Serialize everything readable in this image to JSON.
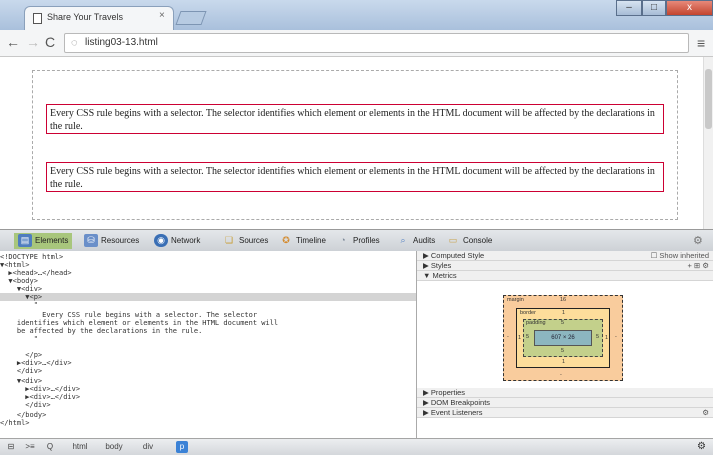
{
  "browser": {
    "tab_title": "Share Your Travels",
    "tab_close": "×",
    "url": "listing03-13.html",
    "window_controls": {
      "minimize": "–",
      "maximize": "□",
      "close": "x"
    }
  },
  "page": {
    "paragraphs": [
      "Every CSS rule begins with a selector. The selector identifies which element or elements in the HTML document will be affected by the declarations in the rule.",
      "Every CSS rule begins with a selector. The selector identifies which element or elements in the HTML document will be affected by the declarations in the rule."
    ]
  },
  "devtools": {
    "tabs": [
      {
        "label": "Elements",
        "icon": "elements-icon",
        "color": "#4f7dbf"
      },
      {
        "label": "Resources",
        "icon": "resources-icon",
        "color": "#6a8fc9"
      },
      {
        "label": "Network",
        "icon": "network-icon",
        "color": "#3a6fb5"
      },
      {
        "label": "Sources",
        "icon": "sources-icon",
        "color": "#e0b84a"
      },
      {
        "label": "Timeline",
        "icon": "timeline-icon",
        "color": "#d48a2c"
      },
      {
        "label": "Profiles",
        "icon": "profiles-icon",
        "color": "#9aa5b3"
      },
      {
        "label": "Audits",
        "icon": "audits-icon",
        "color": "#5b86c4"
      },
      {
        "label": "Console",
        "icon": "console-icon",
        "color": "#c9a24a"
      }
    ],
    "dom_tree": [
      "<!DOCTYPE html>",
      "▼<html>",
      "  ▶<head>…</head>",
      "  ▼<body>",
      "    ▼<div>",
      "      ▼<p>",
      "        \"",
      "          Every CSS rule begins with a selector. The selector",
      "    identifies which element or elements in the HTML document will",
      "    be affected by the declarations in the rule.",
      "        \"",
      "      </p>",
      "    ▶<div>…</div>",
      "    </div>",
      "    ▼<div>",
      "      ▶<div>…</div>",
      "      ▶<div>…</div>",
      "      </div>",
      "    </body>",
      "</html>"
    ],
    "selected_line": 5,
    "sidebar": {
      "computed_style": "▶ Computed Style",
      "show_inherited": "☐ Show inherited",
      "styles": "▶ Styles",
      "styles_tools": "+  ⊞  ⚙",
      "metrics": "▼ Metrics",
      "margin_label": "margin",
      "margin_value": "16",
      "border_label": "border",
      "border_value": "1",
      "padding_label": "padding",
      "padding_value": "5",
      "content_size": "607 × 26",
      "side_dash": "-",
      "properties": "▶ Properties",
      "dom_breakpoints": "▶ DOM Breakpoints",
      "event_listeners": "▶ Event Listeners",
      "event_listeners_right": "⚙"
    },
    "statusbar": {
      "dock": "⊟",
      "console_toggle": ">≡",
      "search": "Q",
      "html": "html",
      "body": "body",
      "div": "div",
      "p": "p",
      "settings": "⚙"
    }
  }
}
